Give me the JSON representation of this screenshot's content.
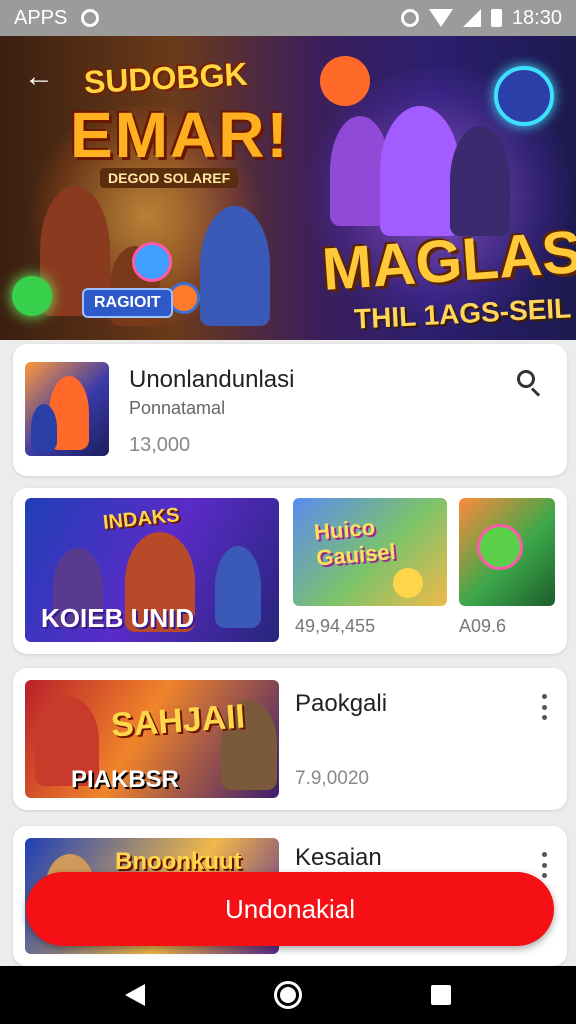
{
  "status_bar": {
    "app_label": "APPS",
    "time": "18:30",
    "icons": [
      "record-icon",
      "alarm-icon",
      "wifi-icon",
      "signal-icon",
      "battery-icon"
    ]
  },
  "banner": {
    "left_title_top": "SUDOBGK",
    "left_title": "EMAR!",
    "left_subtitle": "DEGOD SOLAREF",
    "left_pill": "RAGIOIT",
    "right_title": "MAGLAS",
    "right_subtitle": "THIL 1AGS-SEIL"
  },
  "card1": {
    "title": "Unonlandunlasi",
    "subtitle": "Ponnatamal",
    "count": "13,000"
  },
  "card2": {
    "thumb_main_top": "INDAKS",
    "thumb_main_label": "KOIEB UNID",
    "thumb2_label": "Huico Gauisel",
    "price1": "49,94,455",
    "price2": "A09.6"
  },
  "card3": {
    "thumb_label": "SAHJAII",
    "thumb_label2": "PIAKBSR",
    "title": "Paokgali",
    "count": "7.9,0020"
  },
  "card4": {
    "thumb_label": "Bnoonkuut",
    "title": "Kesaian"
  },
  "cta": {
    "label": "Undonakial"
  },
  "colors": {
    "accent": "#f51015",
    "status_bar": "#9b9b9b",
    "nav_bar": "#000000",
    "page_bg": "#ececec"
  }
}
